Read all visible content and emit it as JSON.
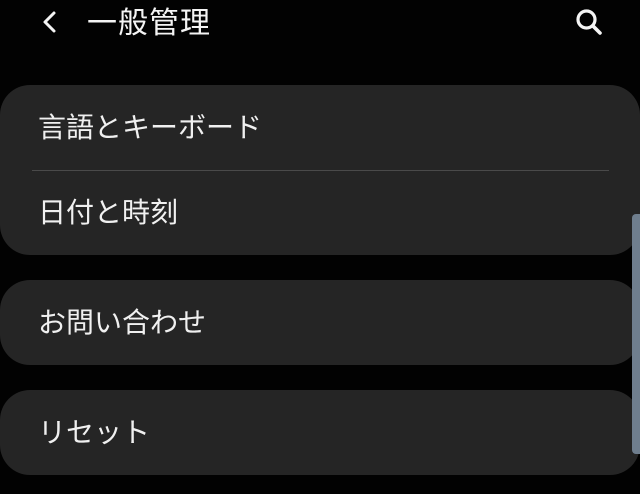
{
  "header": {
    "back_icon": "chevron-left-icon",
    "title": "一般管理",
    "search_icon": "search-icon"
  },
  "groups": [
    {
      "items": [
        {
          "label": "言語とキーボード"
        },
        {
          "label": "日付と時刻"
        }
      ]
    },
    {
      "items": [
        {
          "label": "お問い合わせ"
        }
      ]
    },
    {
      "items": [
        {
          "label": "リセット"
        }
      ]
    }
  ],
  "colors": {
    "background": "#020202",
    "card": "#252525",
    "text": "#f0f0f0",
    "divider": "#4a4a4a",
    "scroll_indicator": "#6f7e8e"
  }
}
